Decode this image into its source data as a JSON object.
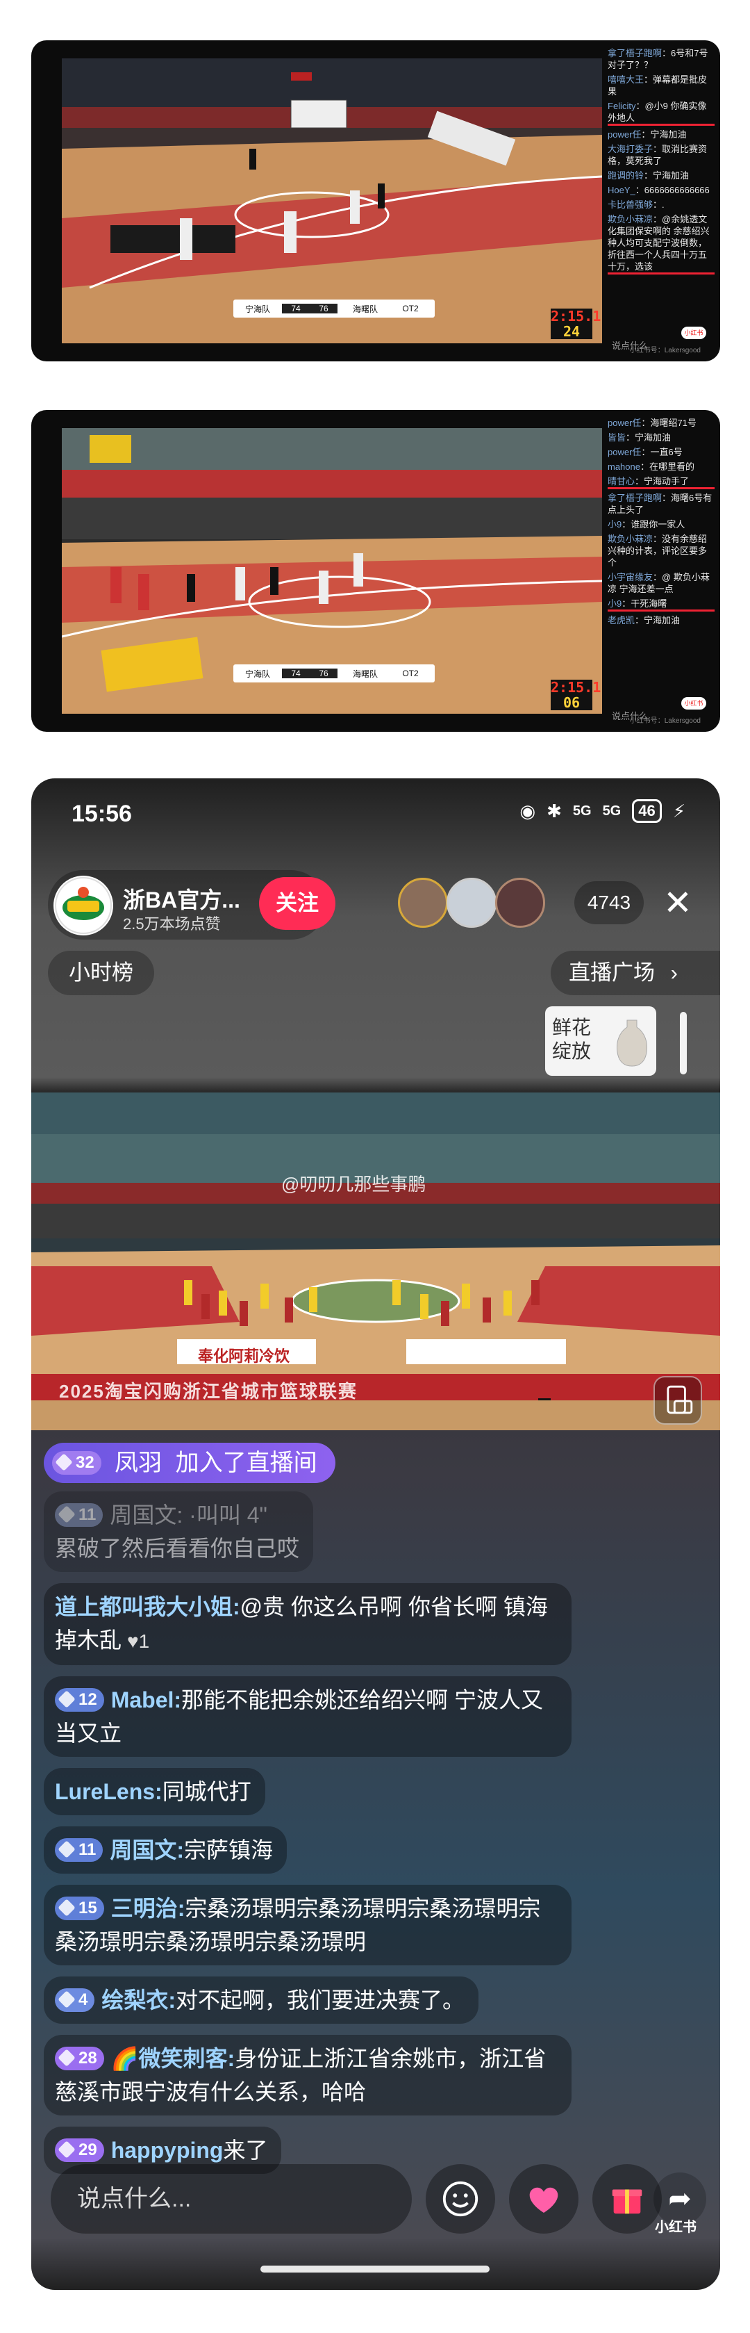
{
  "panel1": {
    "chat": [
      {
        "name": "拿了梧子跑啊",
        "text": "6号和7号对子了？？"
      },
      {
        "name": "嘻嘻大王",
        "text": "弹幕都是批皮果"
      },
      {
        "name": "Felicity",
        "text": "@小9 你确实像外地人"
      },
      {
        "name": "power任",
        "text": "宁海加油"
      },
      {
        "name": "大海打委子",
        "text": "取消比赛资格，莫死我了"
      },
      {
        "name": "跑调的铃",
        "text": "宁海加油"
      },
      {
        "name": "HoeY_",
        "text": "6666666666666"
      },
      {
        "name": "卡比兽强够",
        "text": "."
      },
      {
        "name": "欺负小菻凉",
        "text": "@余姚透文化集团保安啊的 余慈绍兴种人均可支配宁波倒数，折往西一个人兵四十万五十万，选该"
      }
    ],
    "input_placeholder": "说点什么",
    "watermark": "小红书号：Lakersgood",
    "logo": "小红书",
    "clock_time": "2:15.1",
    "shot_clock": "24",
    "scoreboard": {
      "home": "宁海队",
      "home_score": "74",
      "away_score": "76",
      "away": "海曙队",
      "period": "OT2"
    }
  },
  "panel2": {
    "chat": [
      {
        "name": "power任",
        "text": "海曙绍71号"
      },
      {
        "name": "皆皆",
        "text": "宁海加油"
      },
      {
        "name": "power任",
        "text": "一直6号"
      },
      {
        "name": "mahone",
        "text": "在哪里看的"
      },
      {
        "name": "晴甘心",
        "text": "宁海动手了"
      },
      {
        "name": "拿了梧子跑啊",
        "text": "海曙6号有点上头了"
      },
      {
        "name": "小9",
        "text": "谁跟你一家人"
      },
      {
        "name": "欺负小菻凉",
        "text": "没有余慈绍兴种的计表，评论区要多个"
      },
      {
        "name": "小宇宙缘友",
        "text": "@ 欺负小菻凉 宁海还差一点"
      },
      {
        "name": "小9",
        "text": "干死海曙"
      },
      {
        "name": "老虎凯",
        "text": "宁海加油"
      }
    ],
    "input_placeholder": "说点什么",
    "watermark": "小红书号：Lakersgood",
    "logo": "小红书",
    "clock_time": "2:15.1",
    "shot_clock": "06",
    "scoreboard": {
      "home": "宁海队",
      "home_score": "74",
      "away_score": "76",
      "away": "海曙队",
      "period": "OT2"
    }
  },
  "phone": {
    "status": {
      "time": "15:56",
      "signal1": "5G",
      "signal2": "5G",
      "battery": "46"
    },
    "host": {
      "name": "浙BA官方...",
      "likes": "2.5万本场点赞",
      "follow_label": "关注"
    },
    "viewer_count": "4743",
    "hourly_rank": "小时榜",
    "live_square": "直播广场",
    "gift_banner": {
      "line1": "鲜花",
      "line2": "绽放"
    },
    "video": {
      "watermark": "@叨叨几那些事鹏",
      "banner_text": "2025淘宝闪购浙江省城市篮球联赛",
      "ad1": "奉化阿莉冷饮"
    },
    "join_notice": {
      "level": "32",
      "user": "凤羽",
      "text": "加入了直播间"
    },
    "messages": [
      {
        "level": "11",
        "user": "周国文:",
        "text": "累破了然后看看你自己哎",
        "faded": true,
        "prefix": "周国文: ·叫叫 4\""
      },
      {
        "level": "",
        "user": "道上都叫我大小姐:",
        "text": "@贵 你这么吊啊 你省长啊 镇海掉木乱",
        "likes": "1"
      },
      {
        "level": "12",
        "user": "Mabel:",
        "text": "那能不能把余姚还给绍兴啊 宁波人又当又立"
      },
      {
        "level": "",
        "user": "LureLens:",
        "text": "同城代打"
      },
      {
        "level": "11",
        "user": "周国文:",
        "text": "宗萨镇海"
      },
      {
        "level": "15",
        "user": "三明治:",
        "text": "宗桑汤璟明宗桑汤璟明宗桑汤璟明宗桑汤璟明宗桑汤璟明宗桑汤璟明"
      },
      {
        "level": "4",
        "user": "绘梨衣:",
        "text": "对不起啊，我们要进决赛了。"
      },
      {
        "level": "28",
        "user": "🌈微笑刺客:",
        "text": "身份证上浙江省余姚市，浙江省慈溪市跟宁波有什么关系，哈哈"
      },
      {
        "level": "29",
        "user": "happyping",
        "text": "来了"
      }
    ],
    "input_placeholder": "说点什么...",
    "corner_logo": "小红书",
    "colors": {
      "follow": "#ff2c55",
      "join_banner": "#7b5ce8",
      "username": "#9fd4ff"
    }
  }
}
